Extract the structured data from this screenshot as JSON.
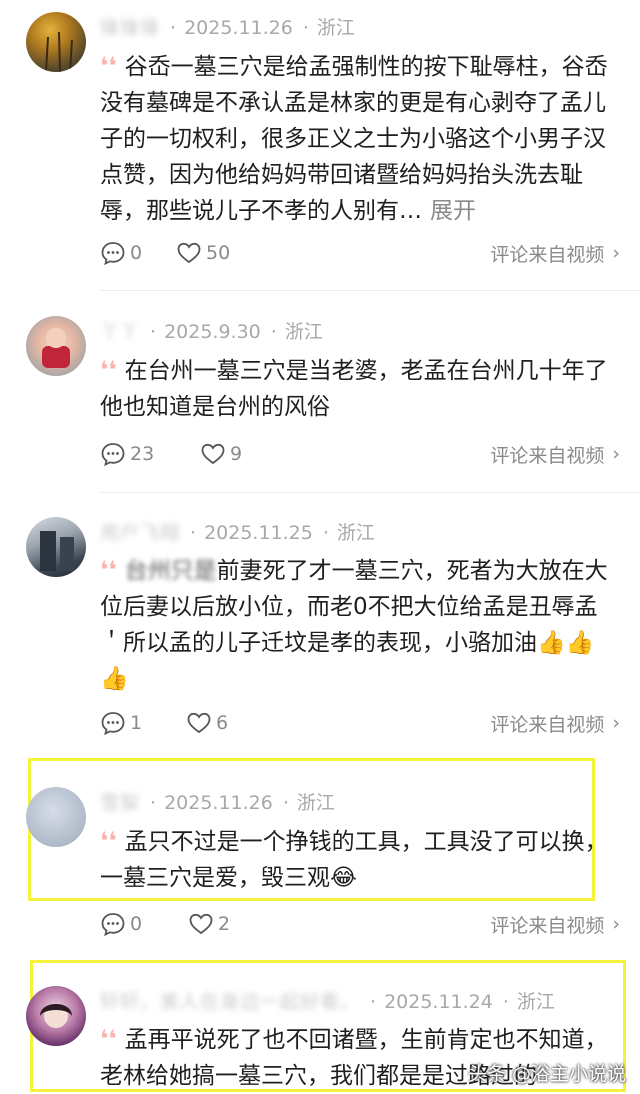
{
  "comments": [
    {
      "name": "锋锋锋",
      "date": "2025.11.26",
      "location": "浙江",
      "text": "谷岙一墓三穴是给孟强制性的按下耻辱柱，谷岙没有墓碑是不承认孟是林家的更是有心剥夺了孟儿子的一切权利，很多正义之士为小骆这个小男子汉点赞，因为他给妈妈带回诸暨给妈妈抬头洗去耻辱，那些说儿子不孝的人别有…",
      "expand": "展开",
      "replies": "0",
      "likes": "50",
      "source": "评论来自视频"
    },
    {
      "name": "丫丫",
      "date": "2025.9.30",
      "location": "浙江",
      "text": "在台州一墓三穴是当老婆，老孟在台州几十年了他也知道是台州的风俗",
      "replies": "23",
      "likes": "9",
      "source": "评论来自视频"
    },
    {
      "name": "用户飞翔",
      "date": "2025.11.25",
      "location": "浙江",
      "text_prefix": "台州只是",
      "text": "前妻死了才一墓三穴，死者为大放在大位后妻以后放小位，而老0不把大位给孟是丑辱孟＇所以孟的儿子迁坟是孝的表现，小骆加油👍👍👍",
      "replies": "1",
      "likes": "6",
      "source": "评论来自视频"
    },
    {
      "name": "雪梨",
      "date": "2025.11.26",
      "location": "浙江",
      "text": "孟只不过是一个挣钱的工具，工具没了可以换，一墓三穴是爱，毁三观😂",
      "replies": "0",
      "likes": "2",
      "source": "评论来自视频"
    },
    {
      "name": "轩轩，美人在身边一起好看。",
      "date": "2025.11.24",
      "location": "浙江",
      "text": "孟再平说死了也不回诸暨，生前肯定也不知道，老林给她搞一墓三穴，我们都是是过路过的"
    }
  ],
  "watermark": "头条 @浴主小说说",
  "colors": {
    "highlight": "#f4f23a",
    "quote": "#f6b6ad",
    "meta": "#a8a8a8"
  }
}
